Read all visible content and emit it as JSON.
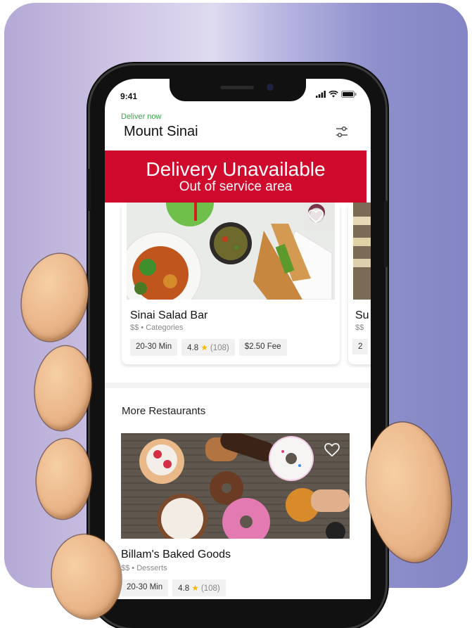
{
  "status_bar": {
    "time": "9:41"
  },
  "header": {
    "deliver_label": "Deliver now",
    "location": "Mount Sinai"
  },
  "banner": {
    "title": "Delivery Unavailable",
    "subtitle": "Out of service area"
  },
  "featured_restaurants": [
    {
      "name": "Sinai Salad Bar",
      "price_level": "$$",
      "category": "Categories",
      "time": "20-30 Min",
      "rating": "4.8",
      "reviews": "(108)",
      "fee": "$2.50 Fee"
    },
    {
      "name_partial": "Su",
      "price_partial": "$$",
      "time_partial": "2"
    }
  ],
  "more_restaurants": {
    "section_title": "More Restaurants",
    "items": [
      {
        "name": "Billam's Baked Goods",
        "price_level": "$$",
        "category": "Desserts",
        "time": "20-30 Min",
        "rating": "4.8",
        "reviews": "(108)"
      }
    ]
  },
  "colors": {
    "banner_bg": "#cf0a2c",
    "deliver_green": "#3aa34a",
    "star": "#f5b800"
  },
  "icons": {
    "filter": "sliders-icon",
    "favorite": "heart-icon",
    "rating": "star-icon"
  }
}
